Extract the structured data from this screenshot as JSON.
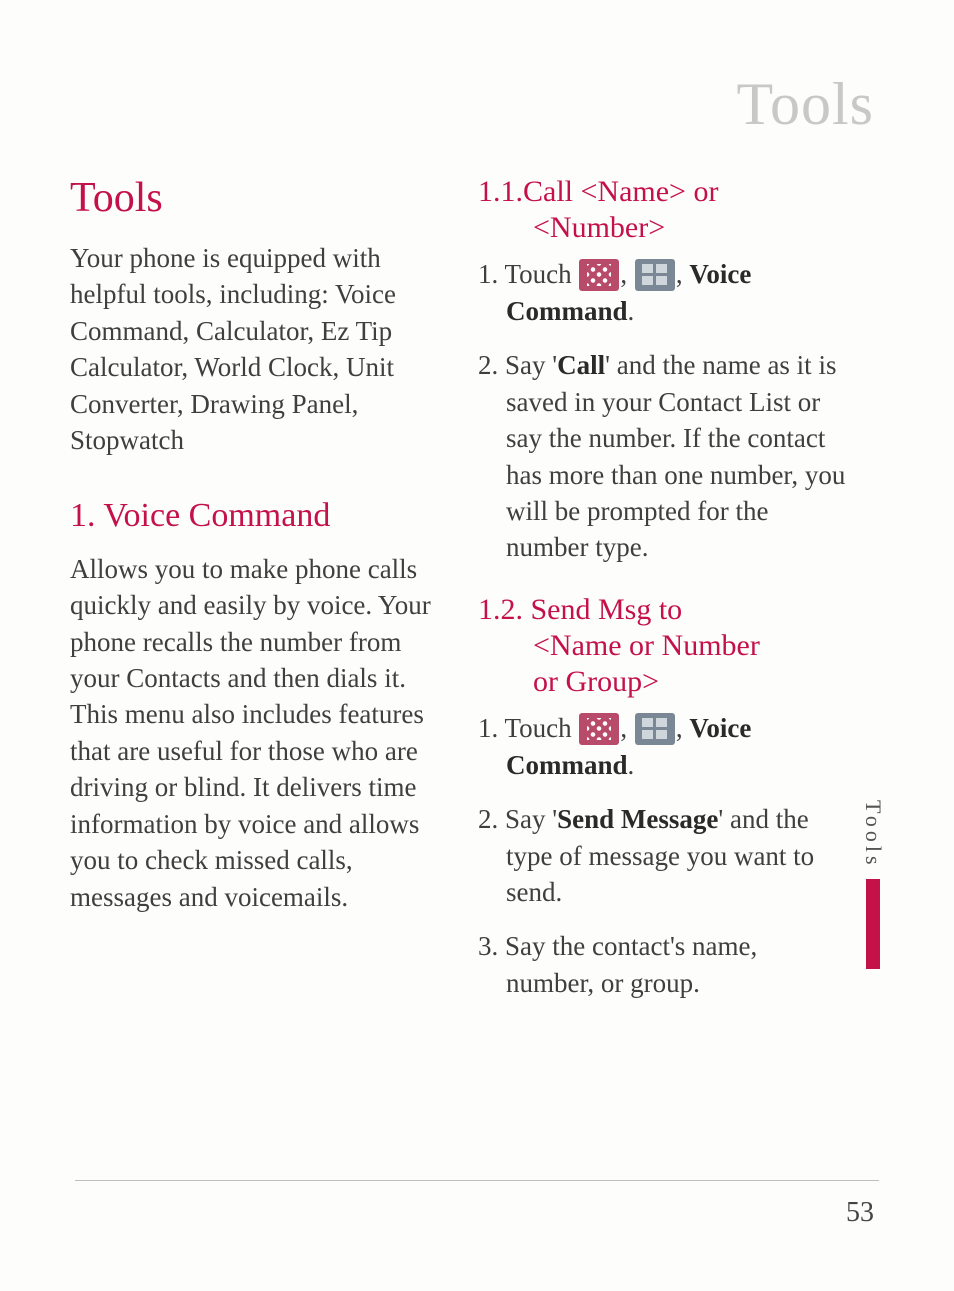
{
  "pageTitle": "Tools",
  "sideTab": "Tools",
  "pageNumber": "53",
  "left": {
    "heading": "Tools",
    "intro": "Your phone is equipped with helpful tools, including: Voice Command, Calculator, Ez Tip Calculator, World Clock, Unit Converter, Drawing Panel, Stopwatch",
    "sec1": {
      "heading": "1. Voice Command",
      "body": "Allows you to make phone calls quickly and easily by voice. Your phone recalls the number from your Contacts and then dials it. This menu also includes features that are useful for those who are driving or blind. It delivers time information by voice and allows you to check missed calls, messages and voicemails."
    }
  },
  "right": {
    "sec11": {
      "heading_l1": "1.1.Call <Name> or",
      "heading_l2": "<Number>",
      "step1_a": "1. Touch ",
      "step1_b": ", ",
      "step1_c": ", ",
      "step1_bold": "Voice Command",
      "step1_d": ".",
      "step2_a": "2. Say '",
      "step2_bold": "Call",
      "step2_b": "' and the name as it is saved in your Contact List or say the number. If the contact has more than one number, you will be prompted for the number type."
    },
    "sec12": {
      "heading_l1": "1.2. Send Msg to",
      "heading_l2": "<Name or Number",
      "heading_l3": "or Group>",
      "step1_a": "1. Touch ",
      "step1_b": ", ",
      "step1_c": ", ",
      "step1_bold": "Voice Command",
      "step1_d": ".",
      "step2_a": "2. Say '",
      "step2_bold": "Send Message",
      "step2_b": "' and the type of message you want to send.",
      "step3": "3. Say the contact's name, number, or group."
    }
  }
}
